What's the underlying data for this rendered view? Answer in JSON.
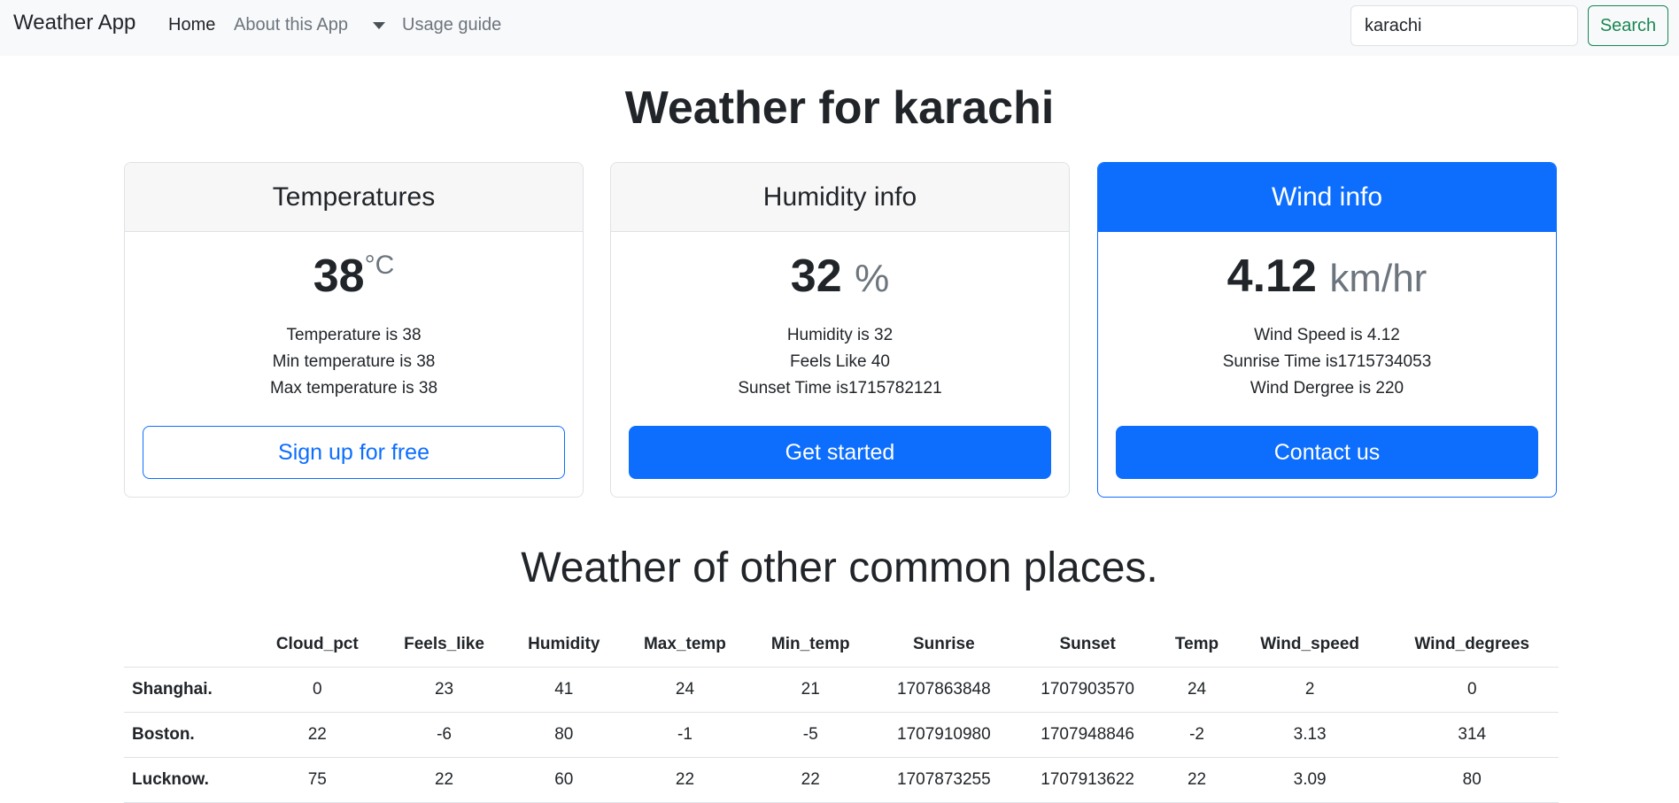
{
  "navbar": {
    "brand": "Weather App",
    "links": [
      {
        "label": "Home",
        "active": true
      },
      {
        "label": "About this App",
        "active": false
      },
      {
        "label": "Usage guide",
        "active": false
      }
    ],
    "search": {
      "value": "karachi",
      "button_label": "Search"
    }
  },
  "page_title": "Weather for karachi",
  "cards": {
    "temperatures": {
      "header": "Temperatures",
      "value": "38",
      "unit": "°C",
      "lines": [
        "Temperature is 38",
        "Min temperature is 38",
        "Max temperature is 38"
      ],
      "button_label": "Sign up for free"
    },
    "humidity": {
      "header": "Humidity info",
      "value": "32",
      "unit": "%",
      "lines": [
        "Humidity is 32",
        "Feels Like 40",
        "Sunset Time is1715782121"
      ],
      "button_label": "Get started"
    },
    "wind": {
      "header": "Wind info",
      "value": "4.12",
      "unit": "km/hr",
      "lines": [
        "Wind Speed is 4.12",
        "Sunrise Time is1715734053",
        "Wind Dergree is 220"
      ],
      "button_label": "Contact us"
    }
  },
  "section_title": "Weather of other common places.",
  "table": {
    "columns": [
      "",
      "Cloud_pct",
      "Feels_like",
      "Humidity",
      "Max_temp",
      "Min_temp",
      "Sunrise",
      "Sunset",
      "Temp",
      "Wind_speed",
      "Wind_degrees"
    ],
    "rows": [
      [
        "Shanghai.",
        "0",
        "23",
        "41",
        "24",
        "21",
        "1707863848",
        "1707903570",
        "24",
        "2",
        "0"
      ],
      [
        "Boston.",
        "22",
        "-6",
        "80",
        "-1",
        "-5",
        "1707910980",
        "1707948846",
        "-2",
        "3.13",
        "314"
      ],
      [
        "Lucknow.",
        "75",
        "22",
        "60",
        "22",
        "22",
        "1707873255",
        "1707913622",
        "22",
        "3.09",
        "80"
      ]
    ]
  },
  "colors": {
    "primary": "#0d6efd",
    "success": "#198754",
    "navbar_bg": "#f8f9fa"
  }
}
